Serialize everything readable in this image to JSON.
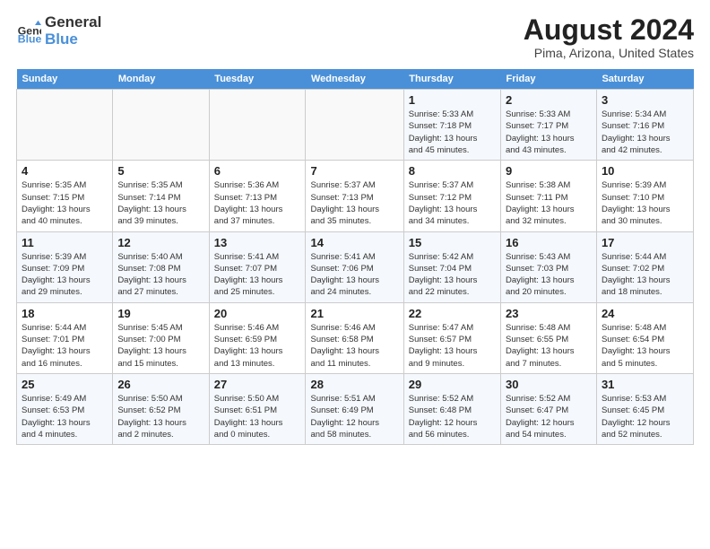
{
  "logo": {
    "line1": "General",
    "line2": "Blue"
  },
  "title": "August 2024",
  "subtitle": "Pima, Arizona, United States",
  "weekdays": [
    "Sunday",
    "Monday",
    "Tuesday",
    "Wednesday",
    "Thursday",
    "Friday",
    "Saturday"
  ],
  "weeks": [
    [
      {
        "day": "",
        "info": ""
      },
      {
        "day": "",
        "info": ""
      },
      {
        "day": "",
        "info": ""
      },
      {
        "day": "",
        "info": ""
      },
      {
        "day": "1",
        "info": "Sunrise: 5:33 AM\nSunset: 7:18 PM\nDaylight: 13 hours\nand 45 minutes."
      },
      {
        "day": "2",
        "info": "Sunrise: 5:33 AM\nSunset: 7:17 PM\nDaylight: 13 hours\nand 43 minutes."
      },
      {
        "day": "3",
        "info": "Sunrise: 5:34 AM\nSunset: 7:16 PM\nDaylight: 13 hours\nand 42 minutes."
      }
    ],
    [
      {
        "day": "4",
        "info": "Sunrise: 5:35 AM\nSunset: 7:15 PM\nDaylight: 13 hours\nand 40 minutes."
      },
      {
        "day": "5",
        "info": "Sunrise: 5:35 AM\nSunset: 7:14 PM\nDaylight: 13 hours\nand 39 minutes."
      },
      {
        "day": "6",
        "info": "Sunrise: 5:36 AM\nSunset: 7:13 PM\nDaylight: 13 hours\nand 37 minutes."
      },
      {
        "day": "7",
        "info": "Sunrise: 5:37 AM\nSunset: 7:13 PM\nDaylight: 13 hours\nand 35 minutes."
      },
      {
        "day": "8",
        "info": "Sunrise: 5:37 AM\nSunset: 7:12 PM\nDaylight: 13 hours\nand 34 minutes."
      },
      {
        "day": "9",
        "info": "Sunrise: 5:38 AM\nSunset: 7:11 PM\nDaylight: 13 hours\nand 32 minutes."
      },
      {
        "day": "10",
        "info": "Sunrise: 5:39 AM\nSunset: 7:10 PM\nDaylight: 13 hours\nand 30 minutes."
      }
    ],
    [
      {
        "day": "11",
        "info": "Sunrise: 5:39 AM\nSunset: 7:09 PM\nDaylight: 13 hours\nand 29 minutes."
      },
      {
        "day": "12",
        "info": "Sunrise: 5:40 AM\nSunset: 7:08 PM\nDaylight: 13 hours\nand 27 minutes."
      },
      {
        "day": "13",
        "info": "Sunrise: 5:41 AM\nSunset: 7:07 PM\nDaylight: 13 hours\nand 25 minutes."
      },
      {
        "day": "14",
        "info": "Sunrise: 5:41 AM\nSunset: 7:06 PM\nDaylight: 13 hours\nand 24 minutes."
      },
      {
        "day": "15",
        "info": "Sunrise: 5:42 AM\nSunset: 7:04 PM\nDaylight: 13 hours\nand 22 minutes."
      },
      {
        "day": "16",
        "info": "Sunrise: 5:43 AM\nSunset: 7:03 PM\nDaylight: 13 hours\nand 20 minutes."
      },
      {
        "day": "17",
        "info": "Sunrise: 5:44 AM\nSunset: 7:02 PM\nDaylight: 13 hours\nand 18 minutes."
      }
    ],
    [
      {
        "day": "18",
        "info": "Sunrise: 5:44 AM\nSunset: 7:01 PM\nDaylight: 13 hours\nand 16 minutes."
      },
      {
        "day": "19",
        "info": "Sunrise: 5:45 AM\nSunset: 7:00 PM\nDaylight: 13 hours\nand 15 minutes."
      },
      {
        "day": "20",
        "info": "Sunrise: 5:46 AM\nSunset: 6:59 PM\nDaylight: 13 hours\nand 13 minutes."
      },
      {
        "day": "21",
        "info": "Sunrise: 5:46 AM\nSunset: 6:58 PM\nDaylight: 13 hours\nand 11 minutes."
      },
      {
        "day": "22",
        "info": "Sunrise: 5:47 AM\nSunset: 6:57 PM\nDaylight: 13 hours\nand 9 minutes."
      },
      {
        "day": "23",
        "info": "Sunrise: 5:48 AM\nSunset: 6:55 PM\nDaylight: 13 hours\nand 7 minutes."
      },
      {
        "day": "24",
        "info": "Sunrise: 5:48 AM\nSunset: 6:54 PM\nDaylight: 13 hours\nand 5 minutes."
      }
    ],
    [
      {
        "day": "25",
        "info": "Sunrise: 5:49 AM\nSunset: 6:53 PM\nDaylight: 13 hours\nand 4 minutes."
      },
      {
        "day": "26",
        "info": "Sunrise: 5:50 AM\nSunset: 6:52 PM\nDaylight: 13 hours\nand 2 minutes."
      },
      {
        "day": "27",
        "info": "Sunrise: 5:50 AM\nSunset: 6:51 PM\nDaylight: 13 hours\nand 0 minutes."
      },
      {
        "day": "28",
        "info": "Sunrise: 5:51 AM\nSunset: 6:49 PM\nDaylight: 12 hours\nand 58 minutes."
      },
      {
        "day": "29",
        "info": "Sunrise: 5:52 AM\nSunset: 6:48 PM\nDaylight: 12 hours\nand 56 minutes."
      },
      {
        "day": "30",
        "info": "Sunrise: 5:52 AM\nSunset: 6:47 PM\nDaylight: 12 hours\nand 54 minutes."
      },
      {
        "day": "31",
        "info": "Sunrise: 5:53 AM\nSunset: 6:45 PM\nDaylight: 12 hours\nand 52 minutes."
      }
    ]
  ]
}
